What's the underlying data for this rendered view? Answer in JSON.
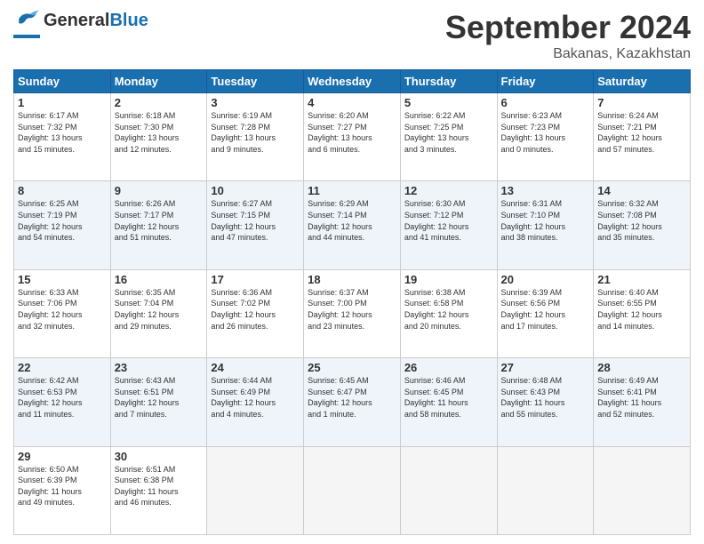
{
  "logo": {
    "text_general": "General",
    "text_blue": "Blue"
  },
  "header": {
    "month_year": "September 2024",
    "location": "Bakanas, Kazakhstan"
  },
  "days_of_week": [
    "Sunday",
    "Monday",
    "Tuesday",
    "Wednesday",
    "Thursday",
    "Friday",
    "Saturday"
  ],
  "weeks": [
    [
      {
        "day": "1",
        "info": "Sunrise: 6:17 AM\nSunset: 7:32 PM\nDaylight: 13 hours\nand 15 minutes."
      },
      {
        "day": "2",
        "info": "Sunrise: 6:18 AM\nSunset: 7:30 PM\nDaylight: 13 hours\nand 12 minutes."
      },
      {
        "day": "3",
        "info": "Sunrise: 6:19 AM\nSunset: 7:28 PM\nDaylight: 13 hours\nand 9 minutes."
      },
      {
        "day": "4",
        "info": "Sunrise: 6:20 AM\nSunset: 7:27 PM\nDaylight: 13 hours\nand 6 minutes."
      },
      {
        "day": "5",
        "info": "Sunrise: 6:22 AM\nSunset: 7:25 PM\nDaylight: 13 hours\nand 3 minutes."
      },
      {
        "day": "6",
        "info": "Sunrise: 6:23 AM\nSunset: 7:23 PM\nDaylight: 13 hours\nand 0 minutes."
      },
      {
        "day": "7",
        "info": "Sunrise: 6:24 AM\nSunset: 7:21 PM\nDaylight: 12 hours\nand 57 minutes."
      }
    ],
    [
      {
        "day": "8",
        "info": "Sunrise: 6:25 AM\nSunset: 7:19 PM\nDaylight: 12 hours\nand 54 minutes."
      },
      {
        "day": "9",
        "info": "Sunrise: 6:26 AM\nSunset: 7:17 PM\nDaylight: 12 hours\nand 51 minutes."
      },
      {
        "day": "10",
        "info": "Sunrise: 6:27 AM\nSunset: 7:15 PM\nDaylight: 12 hours\nand 47 minutes."
      },
      {
        "day": "11",
        "info": "Sunrise: 6:29 AM\nSunset: 7:14 PM\nDaylight: 12 hours\nand 44 minutes."
      },
      {
        "day": "12",
        "info": "Sunrise: 6:30 AM\nSunset: 7:12 PM\nDaylight: 12 hours\nand 41 minutes."
      },
      {
        "day": "13",
        "info": "Sunrise: 6:31 AM\nSunset: 7:10 PM\nDaylight: 12 hours\nand 38 minutes."
      },
      {
        "day": "14",
        "info": "Sunrise: 6:32 AM\nSunset: 7:08 PM\nDaylight: 12 hours\nand 35 minutes."
      }
    ],
    [
      {
        "day": "15",
        "info": "Sunrise: 6:33 AM\nSunset: 7:06 PM\nDaylight: 12 hours\nand 32 minutes."
      },
      {
        "day": "16",
        "info": "Sunrise: 6:35 AM\nSunset: 7:04 PM\nDaylight: 12 hours\nand 29 minutes."
      },
      {
        "day": "17",
        "info": "Sunrise: 6:36 AM\nSunset: 7:02 PM\nDaylight: 12 hours\nand 26 minutes."
      },
      {
        "day": "18",
        "info": "Sunrise: 6:37 AM\nSunset: 7:00 PM\nDaylight: 12 hours\nand 23 minutes."
      },
      {
        "day": "19",
        "info": "Sunrise: 6:38 AM\nSunset: 6:58 PM\nDaylight: 12 hours\nand 20 minutes."
      },
      {
        "day": "20",
        "info": "Sunrise: 6:39 AM\nSunset: 6:56 PM\nDaylight: 12 hours\nand 17 minutes."
      },
      {
        "day": "21",
        "info": "Sunrise: 6:40 AM\nSunset: 6:55 PM\nDaylight: 12 hours\nand 14 minutes."
      }
    ],
    [
      {
        "day": "22",
        "info": "Sunrise: 6:42 AM\nSunset: 6:53 PM\nDaylight: 12 hours\nand 11 minutes."
      },
      {
        "day": "23",
        "info": "Sunrise: 6:43 AM\nSunset: 6:51 PM\nDaylight: 12 hours\nand 7 minutes."
      },
      {
        "day": "24",
        "info": "Sunrise: 6:44 AM\nSunset: 6:49 PM\nDaylight: 12 hours\nand 4 minutes."
      },
      {
        "day": "25",
        "info": "Sunrise: 6:45 AM\nSunset: 6:47 PM\nDaylight: 12 hours\nand 1 minute."
      },
      {
        "day": "26",
        "info": "Sunrise: 6:46 AM\nSunset: 6:45 PM\nDaylight: 11 hours\nand 58 minutes."
      },
      {
        "day": "27",
        "info": "Sunrise: 6:48 AM\nSunset: 6:43 PM\nDaylight: 11 hours\nand 55 minutes."
      },
      {
        "day": "28",
        "info": "Sunrise: 6:49 AM\nSunset: 6:41 PM\nDaylight: 11 hours\nand 52 minutes."
      }
    ],
    [
      {
        "day": "29",
        "info": "Sunrise: 6:50 AM\nSunset: 6:39 PM\nDaylight: 11 hours\nand 49 minutes."
      },
      {
        "day": "30",
        "info": "Sunrise: 6:51 AM\nSunset: 6:38 PM\nDaylight: 11 hours\nand 46 minutes."
      },
      {
        "day": "",
        "info": ""
      },
      {
        "day": "",
        "info": ""
      },
      {
        "day": "",
        "info": ""
      },
      {
        "day": "",
        "info": ""
      },
      {
        "day": "",
        "info": ""
      }
    ]
  ]
}
